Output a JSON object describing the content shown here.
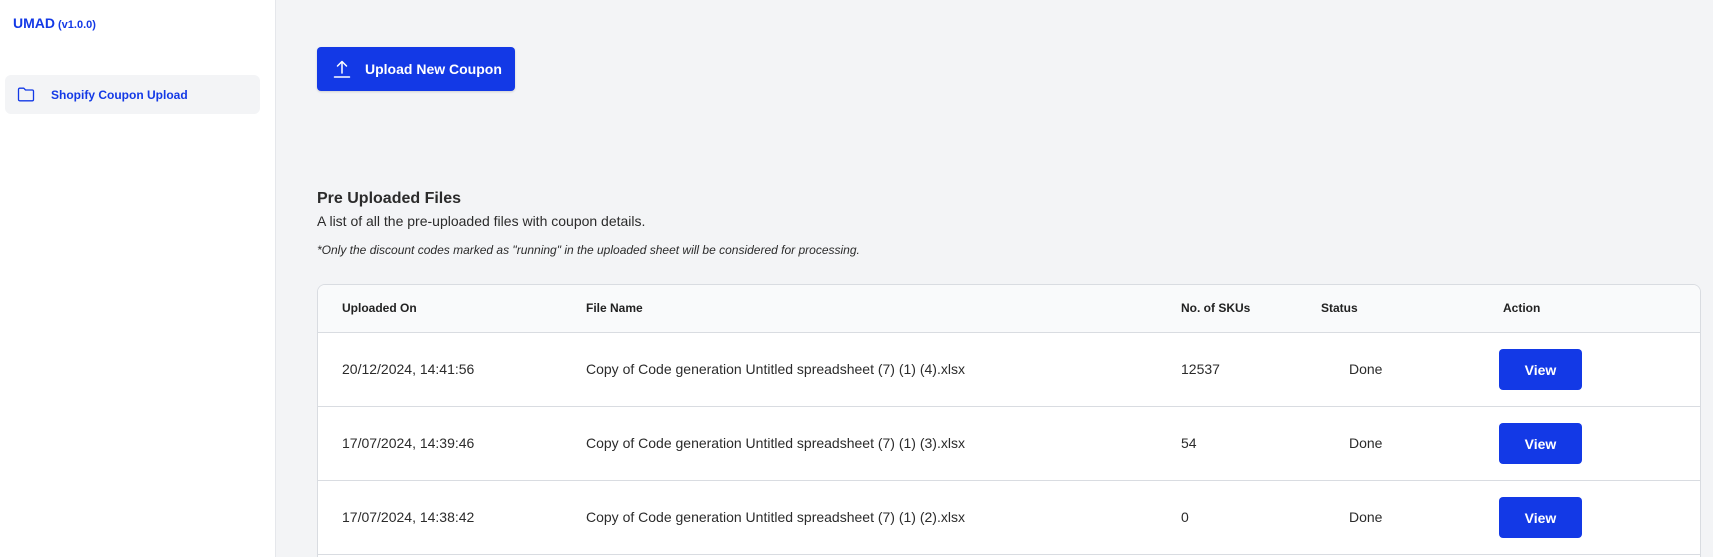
{
  "app": {
    "name": "UMAD",
    "version": "(v1.0.0)"
  },
  "sidebar": {
    "items": [
      {
        "label": "Shopify Coupon Upload",
        "icon": "folder-icon"
      }
    ]
  },
  "toolbar": {
    "upload_label": "Upload New Coupon",
    "upload_icon": "upload-icon"
  },
  "files_section": {
    "title": "Pre Uploaded Files",
    "description": "A list of all the pre-uploaded files with coupon details.",
    "note": "*Only the discount codes marked as \"running\" in the uploaded sheet will be considered for processing."
  },
  "table": {
    "headers": {
      "uploaded_on": "Uploaded On",
      "file_name": "File Name",
      "skus": "No. of SKUs",
      "status": "Status",
      "action": "Action"
    },
    "rows": [
      {
        "uploaded_on": "20/12/2024, 14:41:56",
        "file_name": "Copy of Code generation Untitled spreadsheet (7) (1) (4).xlsx",
        "skus": "12537",
        "status": "Done",
        "action": "View"
      },
      {
        "uploaded_on": "17/07/2024, 14:39:46",
        "file_name": "Copy of Code generation Untitled spreadsheet (7) (1) (3).xlsx",
        "skus": "54",
        "status": "Done",
        "action": "View"
      },
      {
        "uploaded_on": "17/07/2024, 14:38:42",
        "file_name": "Copy of Code generation Untitled spreadsheet (7) (1) (2).xlsx",
        "skus": "0",
        "status": "Done",
        "action": "View"
      }
    ]
  },
  "colors": {
    "accent": "#1339e6",
    "background": "#f3f4f6",
    "surface": "#ffffff",
    "border": "#d9dce1"
  }
}
